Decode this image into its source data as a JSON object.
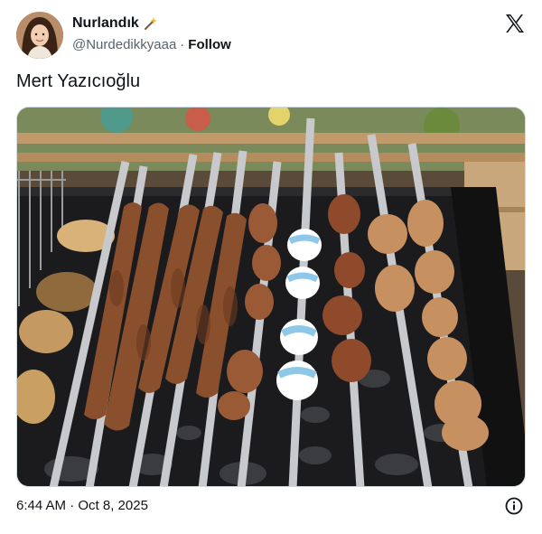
{
  "author": {
    "display_name": "Nurlandık",
    "handle": "@Nurdedikkyaaa",
    "separator": "·",
    "follow_label": "Follow"
  },
  "tweet": {
    "text": "Mert Yazıcıoğlu",
    "timestamp": "6:44 AM · Oct 8, 2025"
  },
  "icons": {
    "brand": "x-logo-icon",
    "info": "info-icon",
    "name_badge": "magic-wand-icon"
  },
  "colors": {
    "text": "#0f1419",
    "secondary_text": "#536471",
    "border": "#cfd9de"
  }
}
